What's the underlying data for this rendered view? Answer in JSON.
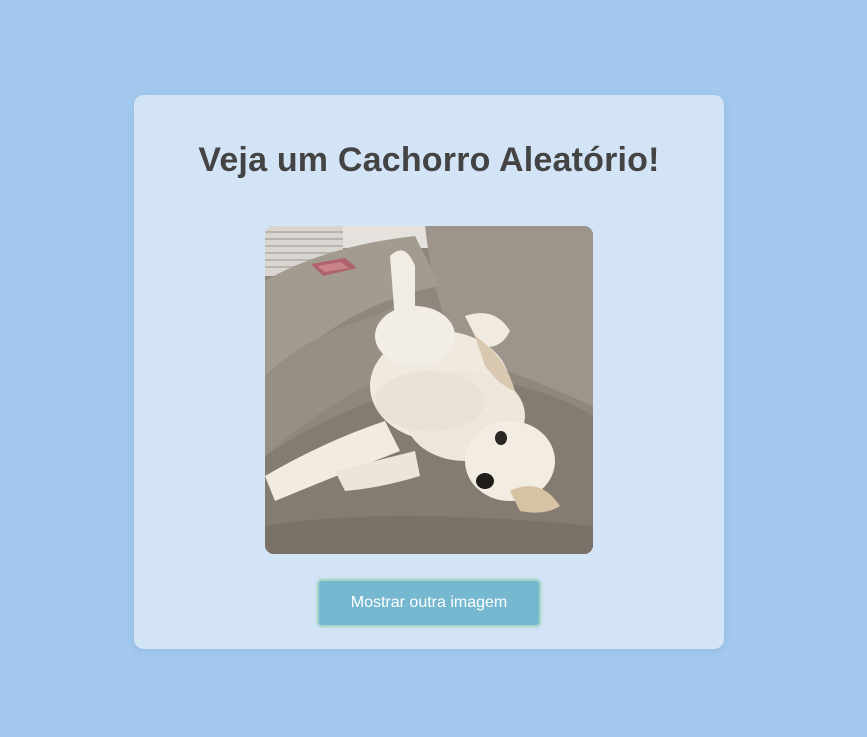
{
  "page": {
    "heading": "Veja um Cachorro Aleatório!",
    "image_alt": "dog-photo",
    "button_label": "Mostrar outra imagem"
  },
  "colors": {
    "page_background": "#a3c9ef",
    "card_background": "#d3e4f7",
    "heading_text": "#444444",
    "button_background": "#75b8d0",
    "button_text": "#ffffff"
  },
  "icons": {
    "photo": "dog-photo-image"
  }
}
